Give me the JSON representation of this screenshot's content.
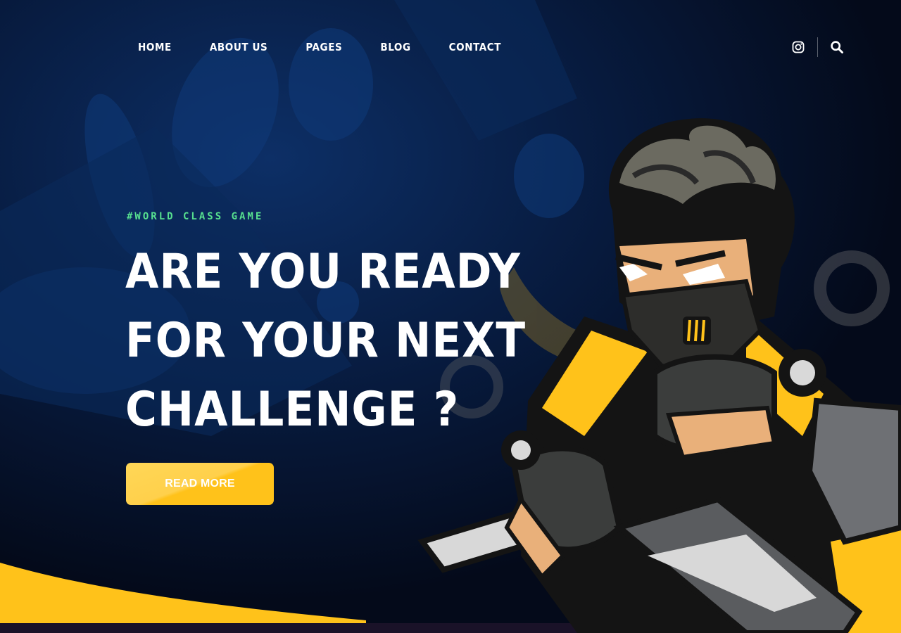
{
  "nav": {
    "items": [
      {
        "label": "HOME"
      },
      {
        "label": "ABOUT US"
      },
      {
        "label": "PAGES"
      },
      {
        "label": "BLOG"
      },
      {
        "label": "CONTACT"
      }
    ],
    "icons": [
      "instagram-icon",
      "search-icon"
    ]
  },
  "hero": {
    "tagline": "#WORLD CLASS GAME",
    "headline": [
      "ARE YOU READY",
      "FOR YOUR NEXT",
      "CHALLENGE ?"
    ],
    "cta_label": "READ MORE"
  },
  "colors": {
    "background": "#050c1f",
    "background_blue": "#0b2a5c",
    "accent_yellow": "#ffc21a",
    "tagline_green": "#57e08f",
    "bottom_band": "#1a1228"
  }
}
